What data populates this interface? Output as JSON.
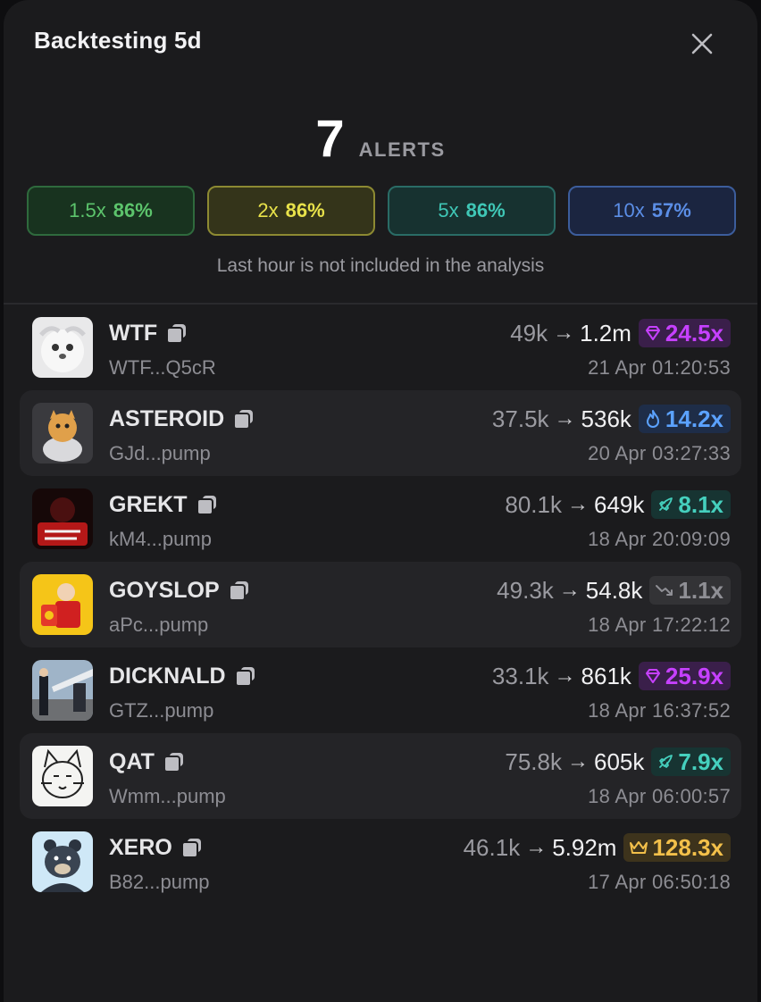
{
  "header": {
    "title": "Backtesting 5d",
    "close_icon": "close-icon"
  },
  "summary": {
    "count": "7",
    "label": "ALERTS"
  },
  "pills": [
    {
      "mult": "1.5x",
      "pct": "86%",
      "color": "#5cc46c"
    },
    {
      "mult": "2x",
      "pct": "86%",
      "color": "#e8e24a"
    },
    {
      "mult": "5x",
      "pct": "86%",
      "color": "#3fc7b6"
    },
    {
      "mult": "10x",
      "pct": "57%",
      "color": "#5b8ee6"
    }
  ],
  "note": "Last hour is not included in the analysis",
  "rows": [
    {
      "name": "WTF",
      "address": "WTF...Q5cR",
      "from": "49k",
      "to": "1.2m",
      "badge": "24.5x",
      "badge_icon": "diamond-icon",
      "date": "21 Apr 01:20:53"
    },
    {
      "name": "ASTEROID",
      "address": "GJd...pump",
      "from": "37.5k",
      "to": "536k",
      "badge": "14.2x",
      "badge_icon": "fire-icon",
      "date": "20 Apr 03:27:33"
    },
    {
      "name": "GREKT",
      "address": "kM4...pump",
      "from": "80.1k",
      "to": "649k",
      "badge": "8.1x",
      "badge_icon": "rocket-icon",
      "date": "18 Apr 20:09:09"
    },
    {
      "name": "GOYSLOP",
      "address": "aPc...pump",
      "from": "49.3k",
      "to": "54.8k",
      "badge": "1.1x",
      "badge_icon": "trend-down-icon",
      "date": "18 Apr 17:22:12"
    },
    {
      "name": "DICKNALD",
      "address": "GTZ...pump",
      "from": "33.1k",
      "to": "861k",
      "badge": "25.9x",
      "badge_icon": "diamond-icon",
      "date": "18 Apr 16:37:52"
    },
    {
      "name": "QAT",
      "address": "Wmm...pump",
      "from": "75.8k",
      "to": "605k",
      "badge": "7.9x",
      "badge_icon": "rocket-icon",
      "date": "18 Apr 06:00:57"
    },
    {
      "name": "XERO",
      "address": "B82...pump",
      "from": "46.1k",
      "to": "5.92m",
      "badge": "128.3x",
      "badge_icon": "crown-icon",
      "date": "17 Apr 06:50:18"
    }
  ],
  "arrow": "→"
}
